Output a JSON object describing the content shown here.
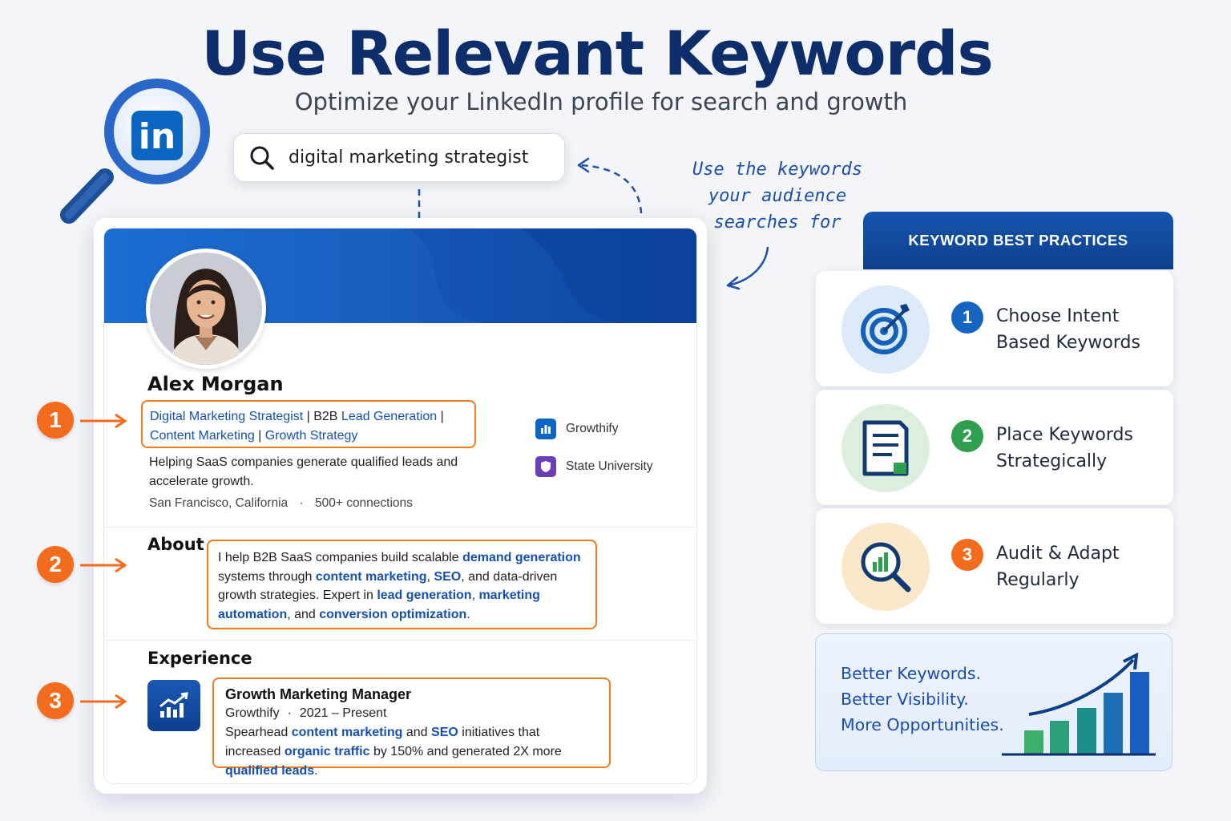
{
  "header": {
    "title": "Use Relevant Keywords",
    "subtitle": "Optimize your LinkedIn profile for search and growth"
  },
  "logo": {
    "icon": "linkedin-magnifier-icon",
    "text": "in"
  },
  "search": {
    "query": "digital marketing strategist",
    "icon": "search-icon"
  },
  "hint": {
    "line1": "Use the keywords",
    "line2": "your audience",
    "line3": "searches for"
  },
  "profile": {
    "name": "Alex Morgan",
    "headline": {
      "k1": "Digital Marketing Strategist",
      "s1": " | B2B ",
      "k2": "Lead Generation",
      "s2": " |",
      "k3": "Content Marketing",
      "s3": " | ",
      "k4": "Growth Strategy"
    },
    "tagline": "Helping SaaS companies generate qualified leads and accelerate growth.",
    "location": "San Francisco, California",
    "sep": "·",
    "connections": "500+ connections",
    "company": "Growthify",
    "school": "State University"
  },
  "about": {
    "title": "About",
    "t1": "I help B2B SaaS companies build scalable ",
    "k1": "demand generation",
    "t2": " systems through ",
    "k2": "content marketing",
    "t3": ", ",
    "k3": "SEO",
    "t4": ", and data-driven growth strategies. Expert in ",
    "k4": "lead generation",
    "t5": ", ",
    "k5": "marketing automation",
    "t6": ", and ",
    "k6": "conversion optimization",
    "t7": "."
  },
  "experience": {
    "title": "Experience",
    "role": "Growth Marketing Manager",
    "company": "Growthify",
    "sep": "·",
    "dates": "2021 – Present",
    "t1": "Spearhead ",
    "k1": "content marketing",
    "t2": " and ",
    "k2": "SEO",
    "t3": " initiatives that increased ",
    "k3": "organic traffic",
    "t4": " by 150% and generated 2X more ",
    "k4": "qualified leads",
    "t5": "."
  },
  "markers": [
    "1",
    "2",
    "3"
  ],
  "best_practices": {
    "title": "KEYWORD BEST PRACTICES",
    "items": [
      {
        "num": "1",
        "line1": "Choose Intent",
        "line2": "Based Keywords",
        "icon": "target-icon",
        "color": "#1565c0"
      },
      {
        "num": "2",
        "line1": "Place Keywords",
        "line2": "Strategically",
        "icon": "document-icon",
        "color": "#2e9e4f"
      },
      {
        "num": "3",
        "line1": "Audit & Adapt",
        "line2": "Regularly",
        "icon": "analytics-magnifier-icon",
        "color": "#f36b1c"
      }
    ]
  },
  "result": {
    "line1": "Better Keywords.",
    "line2": "Better Visibility.",
    "line3": "More Opportunities.",
    "icon": "growth-bar-chart-icon"
  },
  "colors": {
    "brand": "#0d2d6b",
    "accent": "#f36b1c",
    "link": "#1450b4"
  }
}
